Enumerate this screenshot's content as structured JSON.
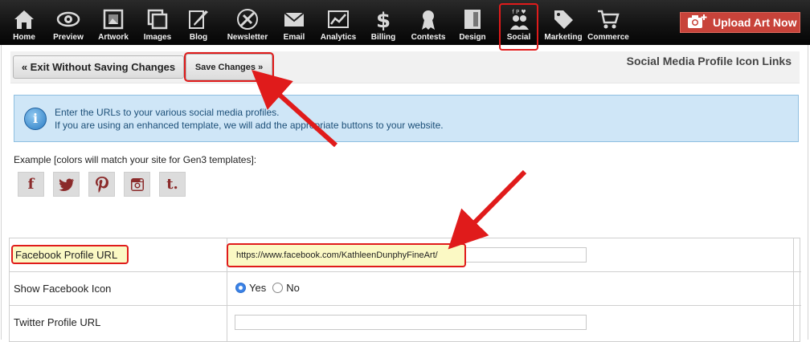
{
  "nav": {
    "items": [
      {
        "label": "Home",
        "icon": "home-icon"
      },
      {
        "label": "Preview",
        "icon": "eye-icon"
      },
      {
        "label": "Artwork",
        "icon": "picture-frame-icon"
      },
      {
        "label": "Images",
        "icon": "images-icon"
      },
      {
        "label": "Blog",
        "icon": "quill-icon"
      },
      {
        "label": "Newsletter",
        "icon": "satellite-icon"
      },
      {
        "label": "Email",
        "icon": "envelope-icon"
      },
      {
        "label": "Analytics",
        "icon": "chart-icon"
      },
      {
        "label": "Billing",
        "icon": "dollar-icon"
      },
      {
        "label": "Contests",
        "icon": "ribbon-icon"
      },
      {
        "label": "Design",
        "icon": "layout-icon"
      },
      {
        "label": "Social",
        "icon": "people-icon",
        "active": true
      },
      {
        "label": "Marketing",
        "icon": "tag-icon"
      },
      {
        "label": "Commerce",
        "icon": "cart-icon"
      }
    ],
    "upload_label": "Upload Art Now",
    "accent": "#e01b1b"
  },
  "toolbar": {
    "exit_label": "« Exit Without Saving Changes",
    "save_label": "Save Changes »",
    "title": "Social Media Profile Icon Links"
  },
  "info": {
    "line1": "Enter the URLs to your various social media profiles.",
    "line2": "If you are using an enhanced template, we will add the appropriate buttons to your website."
  },
  "example": {
    "label": "Example [colors will match your site for Gen3 templates]:",
    "icons": [
      {
        "glyph": "f",
        "icon": "facebook-icon"
      },
      {
        "glyph": "",
        "icon": "twitter-icon"
      },
      {
        "glyph": "",
        "icon": "pinterest-icon"
      },
      {
        "glyph": "",
        "icon": "instagram-icon"
      },
      {
        "glyph": "t.",
        "icon": "tumblr-icon"
      }
    ]
  },
  "form": {
    "facebook_label": "Facebook Profile URL",
    "facebook_value": "https://www.facebook.com/KathleenDunphyFineArt/",
    "show_facebook_label": "Show Facebook Icon",
    "yes_label": "Yes",
    "no_label": "No",
    "show_facebook_selected": "Yes",
    "twitter_label": "Twitter Profile URL",
    "twitter_value": ""
  }
}
